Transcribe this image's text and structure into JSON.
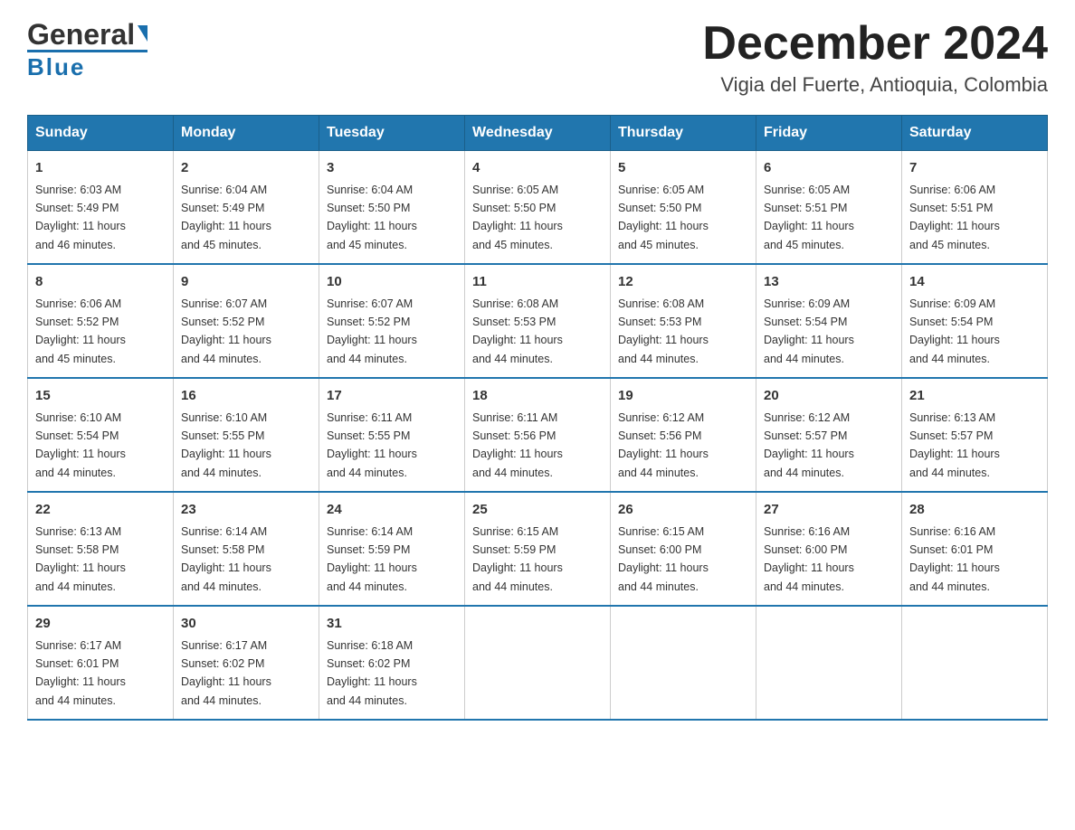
{
  "header": {
    "logo_general": "General",
    "logo_blue": "Blue",
    "month_title": "December 2024",
    "location": "Vigia del Fuerte, Antioquia, Colombia"
  },
  "days_of_week": [
    "Sunday",
    "Monday",
    "Tuesday",
    "Wednesday",
    "Thursday",
    "Friday",
    "Saturday"
  ],
  "weeks": [
    [
      {
        "day": "1",
        "sunrise": "6:03 AM",
        "sunset": "5:49 PM",
        "daylight": "11 hours and 46 minutes."
      },
      {
        "day": "2",
        "sunrise": "6:04 AM",
        "sunset": "5:49 PM",
        "daylight": "11 hours and 45 minutes."
      },
      {
        "day": "3",
        "sunrise": "6:04 AM",
        "sunset": "5:50 PM",
        "daylight": "11 hours and 45 minutes."
      },
      {
        "day": "4",
        "sunrise": "6:05 AM",
        "sunset": "5:50 PM",
        "daylight": "11 hours and 45 minutes."
      },
      {
        "day": "5",
        "sunrise": "6:05 AM",
        "sunset": "5:50 PM",
        "daylight": "11 hours and 45 minutes."
      },
      {
        "day": "6",
        "sunrise": "6:05 AM",
        "sunset": "5:51 PM",
        "daylight": "11 hours and 45 minutes."
      },
      {
        "day": "7",
        "sunrise": "6:06 AM",
        "sunset": "5:51 PM",
        "daylight": "11 hours and 45 minutes."
      }
    ],
    [
      {
        "day": "8",
        "sunrise": "6:06 AM",
        "sunset": "5:52 PM",
        "daylight": "11 hours and 45 minutes."
      },
      {
        "day": "9",
        "sunrise": "6:07 AM",
        "sunset": "5:52 PM",
        "daylight": "11 hours and 44 minutes."
      },
      {
        "day": "10",
        "sunrise": "6:07 AM",
        "sunset": "5:52 PM",
        "daylight": "11 hours and 44 minutes."
      },
      {
        "day": "11",
        "sunrise": "6:08 AM",
        "sunset": "5:53 PM",
        "daylight": "11 hours and 44 minutes."
      },
      {
        "day": "12",
        "sunrise": "6:08 AM",
        "sunset": "5:53 PM",
        "daylight": "11 hours and 44 minutes."
      },
      {
        "day": "13",
        "sunrise": "6:09 AM",
        "sunset": "5:54 PM",
        "daylight": "11 hours and 44 minutes."
      },
      {
        "day": "14",
        "sunrise": "6:09 AM",
        "sunset": "5:54 PM",
        "daylight": "11 hours and 44 minutes."
      }
    ],
    [
      {
        "day": "15",
        "sunrise": "6:10 AM",
        "sunset": "5:54 PM",
        "daylight": "11 hours and 44 minutes."
      },
      {
        "day": "16",
        "sunrise": "6:10 AM",
        "sunset": "5:55 PM",
        "daylight": "11 hours and 44 minutes."
      },
      {
        "day": "17",
        "sunrise": "6:11 AM",
        "sunset": "5:55 PM",
        "daylight": "11 hours and 44 minutes."
      },
      {
        "day": "18",
        "sunrise": "6:11 AM",
        "sunset": "5:56 PM",
        "daylight": "11 hours and 44 minutes."
      },
      {
        "day": "19",
        "sunrise": "6:12 AM",
        "sunset": "5:56 PM",
        "daylight": "11 hours and 44 minutes."
      },
      {
        "day": "20",
        "sunrise": "6:12 AM",
        "sunset": "5:57 PM",
        "daylight": "11 hours and 44 minutes."
      },
      {
        "day": "21",
        "sunrise": "6:13 AM",
        "sunset": "5:57 PM",
        "daylight": "11 hours and 44 minutes."
      }
    ],
    [
      {
        "day": "22",
        "sunrise": "6:13 AM",
        "sunset": "5:58 PM",
        "daylight": "11 hours and 44 minutes."
      },
      {
        "day": "23",
        "sunrise": "6:14 AM",
        "sunset": "5:58 PM",
        "daylight": "11 hours and 44 minutes."
      },
      {
        "day": "24",
        "sunrise": "6:14 AM",
        "sunset": "5:59 PM",
        "daylight": "11 hours and 44 minutes."
      },
      {
        "day": "25",
        "sunrise": "6:15 AM",
        "sunset": "5:59 PM",
        "daylight": "11 hours and 44 minutes."
      },
      {
        "day": "26",
        "sunrise": "6:15 AM",
        "sunset": "6:00 PM",
        "daylight": "11 hours and 44 minutes."
      },
      {
        "day": "27",
        "sunrise": "6:16 AM",
        "sunset": "6:00 PM",
        "daylight": "11 hours and 44 minutes."
      },
      {
        "day": "28",
        "sunrise": "6:16 AM",
        "sunset": "6:01 PM",
        "daylight": "11 hours and 44 minutes."
      }
    ],
    [
      {
        "day": "29",
        "sunrise": "6:17 AM",
        "sunset": "6:01 PM",
        "daylight": "11 hours and 44 minutes."
      },
      {
        "day": "30",
        "sunrise": "6:17 AM",
        "sunset": "6:02 PM",
        "daylight": "11 hours and 44 minutes."
      },
      {
        "day": "31",
        "sunrise": "6:18 AM",
        "sunset": "6:02 PM",
        "daylight": "11 hours and 44 minutes."
      },
      null,
      null,
      null,
      null
    ]
  ]
}
